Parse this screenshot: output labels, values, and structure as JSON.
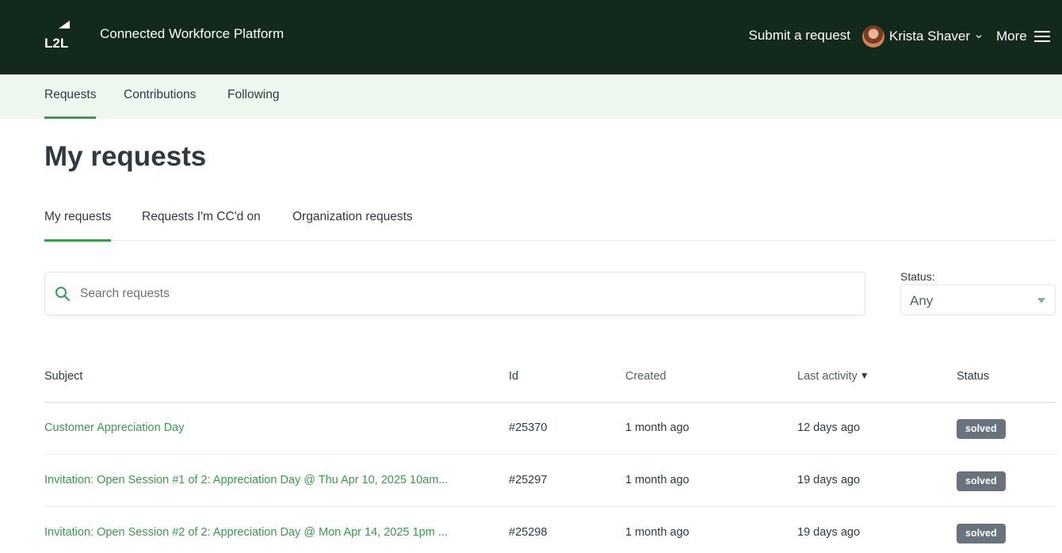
{
  "header": {
    "logo_text": "L2L",
    "brand_title": "Connected Workforce Platform",
    "submit_request": "Submit a request",
    "user_name": "Krista Shaver",
    "more_label": "More",
    "background": "#12291c"
  },
  "subnav": {
    "items": [
      {
        "label": "Requests",
        "active": true
      },
      {
        "label": "Contributions",
        "active": false
      },
      {
        "label": "Following",
        "active": false
      }
    ],
    "background": "#edf7ee"
  },
  "page": {
    "title": "My requests"
  },
  "tabs": [
    {
      "label": "My requests",
      "active": true
    },
    {
      "label": "Requests I'm CC'd on",
      "active": false
    },
    {
      "label": "Organization requests",
      "active": false
    }
  ],
  "search": {
    "placeholder": "Search requests",
    "value": ""
  },
  "status_filter": {
    "label": "Status:",
    "selected": "Any"
  },
  "table": {
    "headers": {
      "subject": "Subject",
      "id": "Id",
      "created": "Created",
      "last_activity": "Last activity",
      "last_activity_sort": "▼",
      "status": "Status"
    },
    "rows": [
      {
        "subject": "Customer Appreciation Day",
        "id": "#25370",
        "created": "1 month ago",
        "last_activity": "12 days ago",
        "status": "solved"
      },
      {
        "subject": "Invitation: Open Session #1 of 2: Appreciation Day @ Thu Apr 10, 2025 10am...",
        "id": "#25297",
        "created": "1 month ago",
        "last_activity": "19 days ago",
        "status": "solved"
      },
      {
        "subject": "Invitation: Open Session #2 of 2: Appreciation Day @ Mon Apr 14, 2025 1pm ...",
        "id": "#25298",
        "created": "1 month ago",
        "last_activity": "19 days ago",
        "status": "solved"
      }
    ]
  },
  "colors": {
    "accent": "#3a9a4e",
    "badge": "#68737d"
  },
  "icons": {
    "search": "search-icon",
    "menu": "hamburger-icon",
    "chevron": "chevron-down-icon"
  }
}
